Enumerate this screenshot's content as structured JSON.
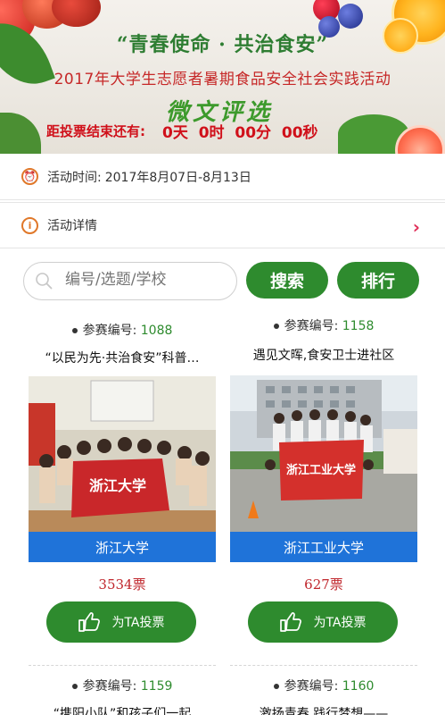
{
  "banner": {
    "title": "“青春使命 · 共治食安”",
    "subtitle": "2017年大学生志愿者暑期食品安全社会实践活动",
    "micro_title": "微文评选",
    "countdown_label": "距投票结束还有:",
    "countdown_days": "0天",
    "countdown_hours": "0时",
    "countdown_minutes": "00分",
    "countdown_seconds": "00秒"
  },
  "info": {
    "time_label": "活动时间:",
    "time_value": "2017年8月07日-8月13日",
    "details_label": "活动详情"
  },
  "search": {
    "placeholder": "编号/选题/学校",
    "search_button": "搜索",
    "rank_button": "排行"
  },
  "cards": [
    {
      "no_label": "参赛编号:",
      "no": "1088",
      "title": "“以民为先·共治食安”科普…",
      "school": "浙江大学",
      "votes": "3534票",
      "vote_button": "为TA投票"
    },
    {
      "no_label": "参赛编号:",
      "no": "1158",
      "title": "遇见文晖,食安卫士进社区",
      "school": "浙江工业大学",
      "votes": "627票",
      "vote_button": "为TA投票"
    },
    {
      "no_label": "参赛编号:",
      "no": "1159",
      "title": "“携阳小队”和孩子们一起",
      "school": "",
      "votes": "",
      "vote_button": ""
    },
    {
      "no_label": "参赛编号:",
      "no": "1160",
      "title": "激扬青春,践行梦想——",
      "school": "",
      "votes": "",
      "vote_button": ""
    }
  ],
  "colors": {
    "green": "#2e8b2e",
    "red": "#c0262c",
    "blue": "#1f73d9",
    "accent": "#e0782a"
  }
}
